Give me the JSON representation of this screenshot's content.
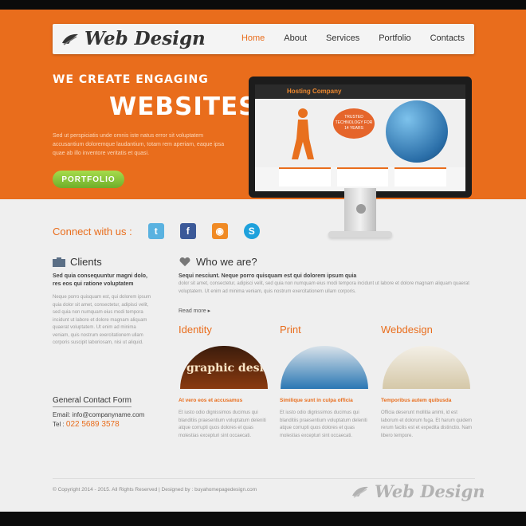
{
  "header": {
    "logo_text": "Web Design",
    "nav": [
      {
        "label": "Home",
        "active": true
      },
      {
        "label": "About"
      },
      {
        "label": "Services"
      },
      {
        "label": "Portfolio"
      },
      {
        "label": "Contacts"
      }
    ]
  },
  "hero": {
    "tagline_line1": "WE CREATE ENGAGING",
    "tagline_line2": "WEBSITES",
    "description": "Sed ut perspiciatis unde omnis iste natus error sit voluptatem accusantium doloremque laudantium, totam rem aperiam, eaque ipsa quae ab illo inventore veritatis et quasi.",
    "button_label": "PORTFOLIO",
    "monitor_screen": {
      "site_title": "Hosting Company",
      "bubble_text": "TRUSTED TECHNOLOGY FOR 14 YEARS"
    }
  },
  "connect": {
    "label": "Connect with us :",
    "icons": [
      "twitter-icon",
      "facebook-icon",
      "rss-icon",
      "skype-icon"
    ]
  },
  "clients": {
    "title": "Clients",
    "lead": "Sed quia consequuntur magni dolo, res eos qui ratione voluptatem",
    "text": "Neque porro quisquam est, qui dolorem ipsum quia dolor sit amet, consectetur, adipisci velit, sed quia non numquam eius modi tempora incidunt ut labore et dolore magnam aliquam quaerat voluptatem. Ut enim ad minima veniam, quis nostrum exercitationem ullam corporis suscipit laboriosam, nisi ut aliquid."
  },
  "who": {
    "title": "Who we are?",
    "lead": "Sequi nesciunt. Neque porro quisquam est qui dolorem ipsum quia",
    "text": "dolor sit amet, consectetur, adipisci velit, sed quia non numquam eius modi tempora incidunt ut labore et dolore magnam aliquam quaerat voluptatem. Ut enim ad minima veniam, quis nostrum exercitationem ullam corporis.",
    "read_more": "Read more ▸"
  },
  "columns": [
    {
      "title": "Identity",
      "image_text": "graphic design",
      "lead": "At vero eos et accusamus",
      "text": "Et iusto odio dignissimos ducimus qui blanditiis praesentium voluptatum deleniti atque corrupti quos dolores et quas molestias excepturi sint occaecati."
    },
    {
      "title": "Print",
      "image_text": "",
      "lead": "Similique sunt in culpa officia",
      "text": "Et iusto odio dignissimos ducimus qui blanditiis praesentium voluptatum deleniti atque corrupti quos dolores et quas molestias excepturi sint occaecati."
    },
    {
      "title": "Webdesign",
      "image_text": "",
      "lead": "Temporibus autem quibusda",
      "text": "Officia deserunt mollitia animi, id est laborum et dolorum fuga. Et harum quidem rerum facilis est et expedita distinctio. Nam libero tempore."
    }
  ],
  "contact": {
    "title": "General Contact Form",
    "email_label": "Email:",
    "email": "info@companyname.com",
    "tel_label": "Tel :",
    "tel": "022 5689 3578"
  },
  "footer": {
    "copyright": "© Copyright 2014 - 2015. All Rights Reserved | Designed by : buyahomepagedesign.com",
    "logo_text": "Web Design"
  },
  "colors": {
    "accent": "#e96d1c",
    "button": "#8cc63f",
    "background": "#efefef"
  }
}
